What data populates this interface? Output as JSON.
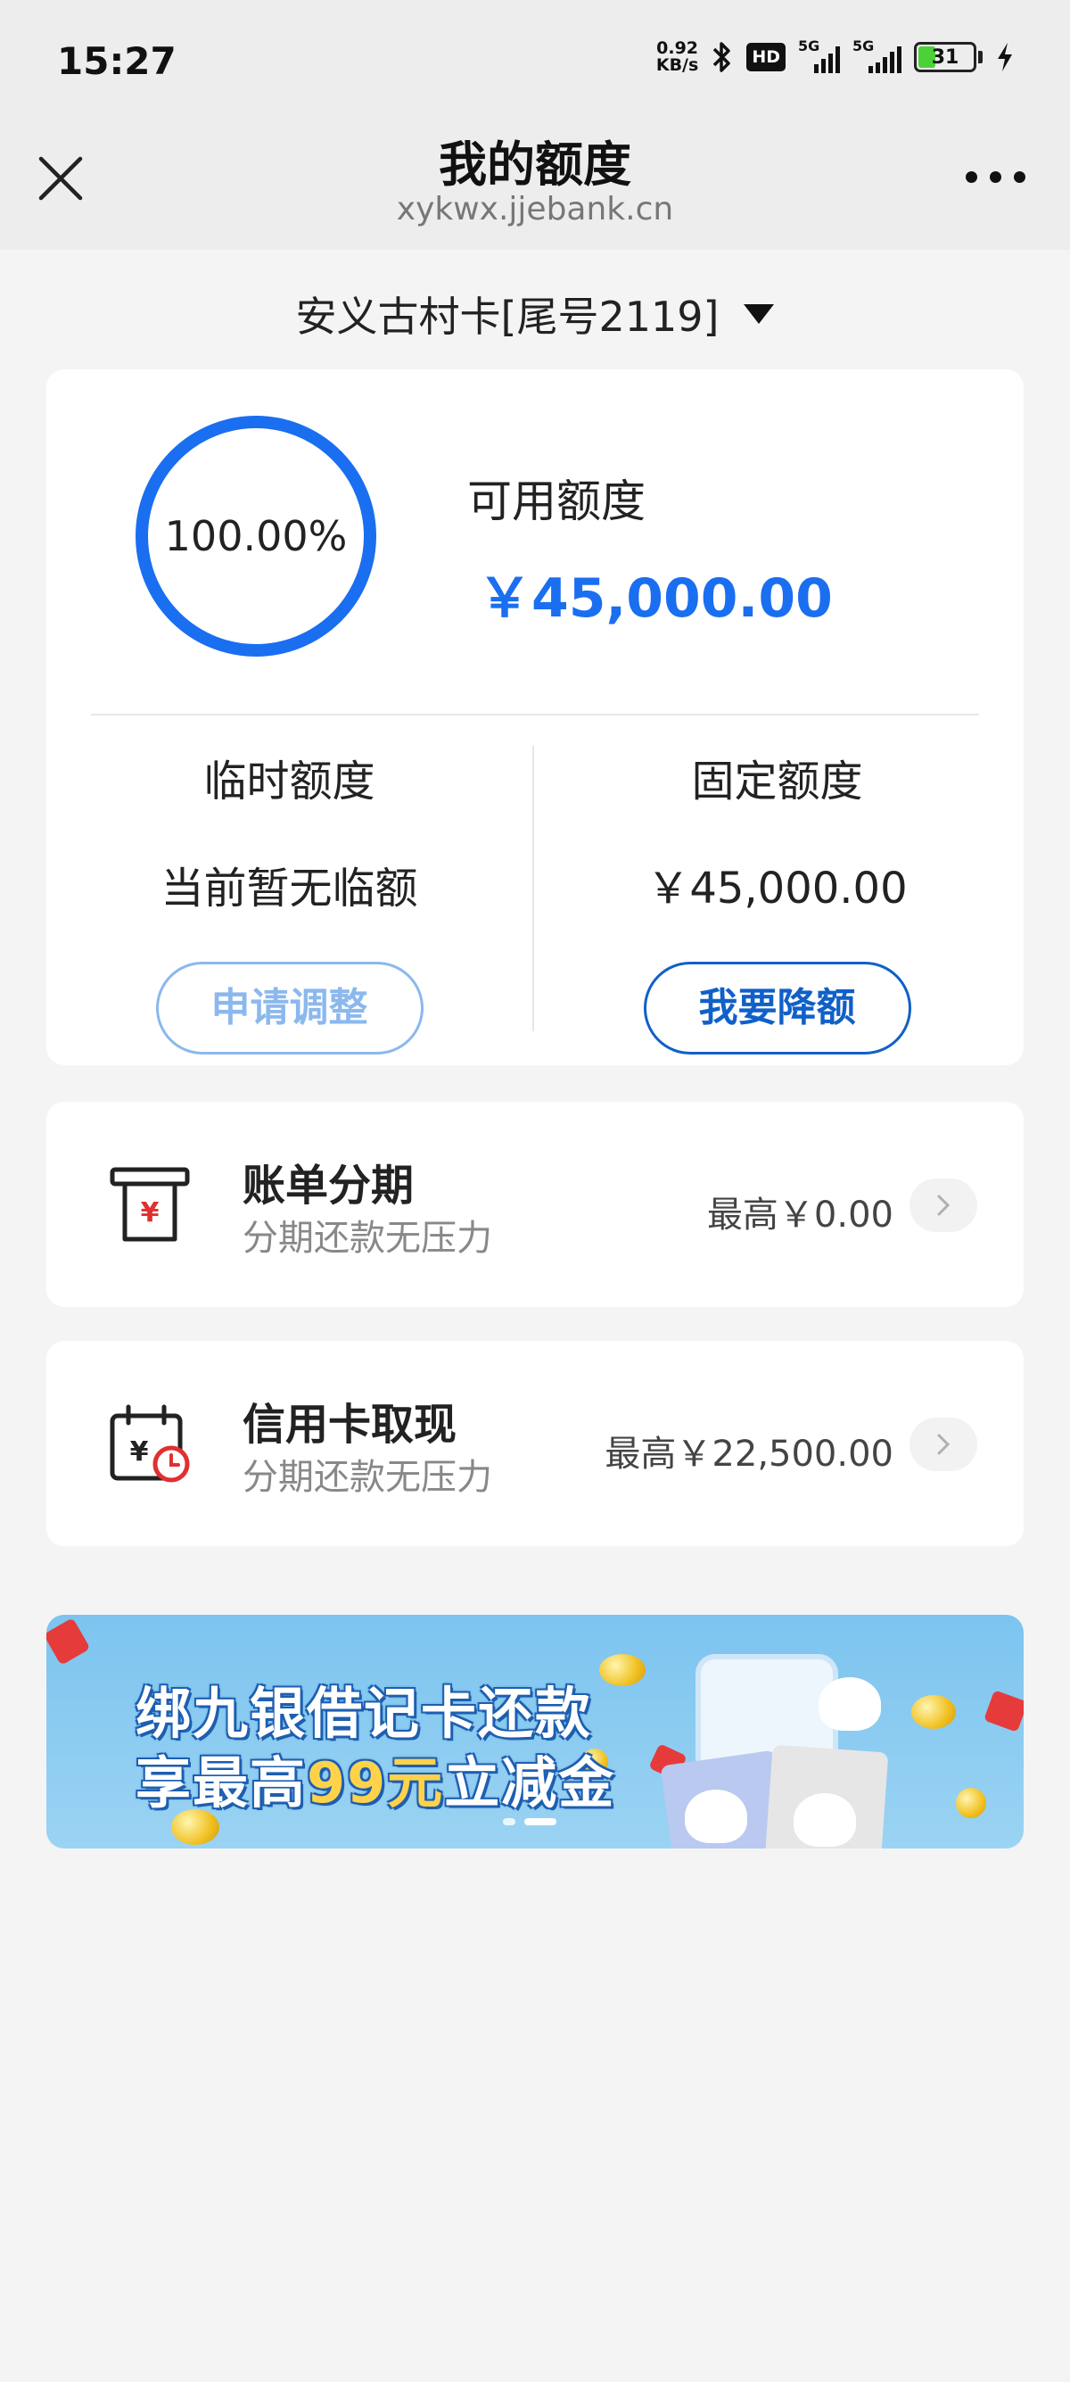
{
  "status_bar": {
    "time": "15:27",
    "net_speed_value": "0.92",
    "net_speed_unit": "KB/s",
    "hd_label": "HD",
    "signal1_label": "5G",
    "signal2_label": "5G",
    "battery_level": "31"
  },
  "title_bar": {
    "title": "我的额度",
    "url": "xykwx.jjebank.cn"
  },
  "card_selector": {
    "label": "安义古村卡[尾号2119]"
  },
  "limit_card": {
    "percent": "100.00%",
    "percent_value": 100,
    "available_label": "可用额度",
    "available_amount": "￥45,000.00",
    "temp_title": "临时额度",
    "temp_value": "当前暂无临额",
    "temp_button": "申请调整",
    "fixed_title": "固定额度",
    "fixed_value": "￥45,000.00",
    "fixed_button": "我要降额"
  },
  "services": [
    {
      "title": "账单分期",
      "subtitle": "分期还款无压力",
      "max": "最高￥0.00"
    },
    {
      "title": "信用卡取现",
      "subtitle": "分期还款无压力",
      "max": "最高￥22,500.00"
    }
  ],
  "banner": {
    "line1": "绑九银借记卡还款",
    "line2_prefix": "享最高",
    "line2_highlight": "99元",
    "line2_suffix": "立减金"
  },
  "colors": {
    "accent": "#1a6ef0",
    "button_dark": "#1060c8",
    "button_light": "#8bb8ee",
    "page_bg": "#f4f4f5",
    "banner_bg": "#8ccbf1"
  }
}
